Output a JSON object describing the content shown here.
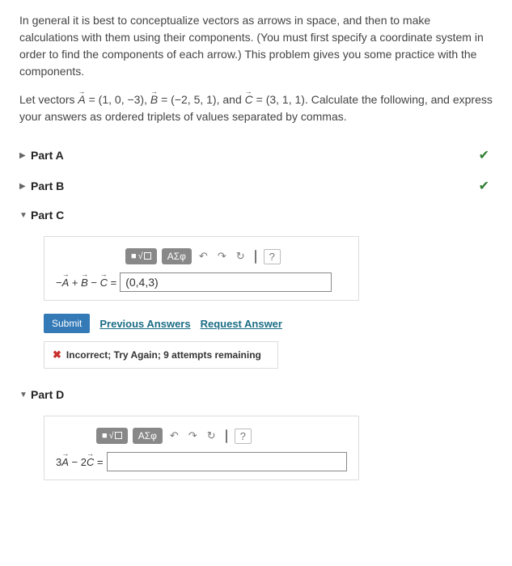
{
  "intro": "In general it is best to conceptualize vectors as arrows in space, and then to make calculations with them using their components. (You must first specify a coordinate system in order to find the components of each arrow.) This problem gives you some practice with the components.",
  "setup_p1": "Let vectors ",
  "setup_A": "A",
  "setup_Aval": " = (1, 0, −3)",
  "setup_sep1": ", ",
  "setup_B": "B",
  "setup_Bval": " = (−2, 5, 1)",
  "setup_sep2": ", and ",
  "setup_C": "C",
  "setup_Cval": " = (3, 1, 1)",
  "setup_p2": ". Calculate the following, and express your answers as ordered triplets of values separated by commas.",
  "parts": {
    "a": {
      "label": "Part A"
    },
    "b": {
      "label": "Part B"
    },
    "c": {
      "label": "Part C"
    },
    "d": {
      "label": "Part D"
    }
  },
  "toolbar": {
    "greek": "ΑΣφ",
    "help": "?"
  },
  "partC": {
    "eq_prefix": "−",
    "eq_A": "A",
    "eq_plus": " + ",
    "eq_B": "B",
    "eq_minus": " − ",
    "eq_C": "C",
    "eq_eq": " = ",
    "answer": "(0,4,3)"
  },
  "actions": {
    "submit": "Submit",
    "previous": "Previous Answers",
    "request": "Request Answer"
  },
  "feedback": {
    "text": "Incorrect; Try Again; 9 attempts remaining"
  },
  "partD": {
    "eq_coef1": "3",
    "eq_A": "A",
    "eq_minus": " − ",
    "eq_coef2": "2",
    "eq_C": "C",
    "eq_eq": " = ",
    "answer": ""
  }
}
